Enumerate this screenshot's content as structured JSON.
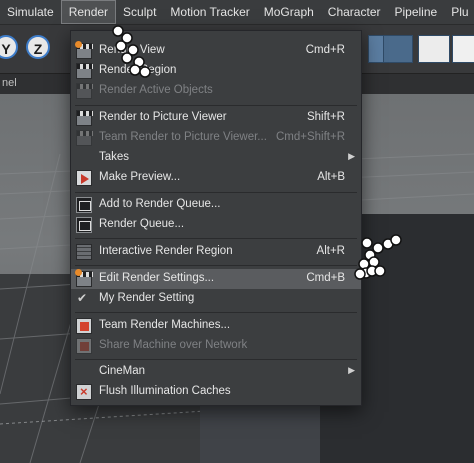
{
  "menubar": {
    "items": [
      "Simulate",
      "Render",
      "Sculpt",
      "Motion Tracker",
      "MoGraph",
      "Character",
      "Pipeline",
      "Plu"
    ]
  },
  "toolbar": {
    "icon_y": "Y",
    "icon_z": "Z"
  },
  "subbar": {
    "label": "nel"
  },
  "menu": {
    "items": [
      {
        "label": "Render View",
        "shortcut": "Cmd+R",
        "icon": "clapper-icon",
        "disabled": false
      },
      {
        "label": "Render Region",
        "shortcut": "",
        "icon": "clapper-icon",
        "disabled": false
      },
      {
        "label": "Render Active Objects",
        "shortcut": "",
        "icon": "clapper-icon",
        "disabled": true
      },
      {
        "label": "Render to Picture Viewer",
        "shortcut": "Shift+R",
        "icon": "clapper-icon",
        "disabled": false
      },
      {
        "label": "Team Render to Picture Viewer...",
        "shortcut": "Cmd+Shift+R",
        "icon": "clapper-icon",
        "disabled": true
      },
      {
        "label": "Takes",
        "shortcut": "",
        "icon": "",
        "disabled": false,
        "submenu": true
      },
      {
        "label": "Make Preview...",
        "shortcut": "Alt+B",
        "icon": "preview-icon",
        "disabled": false
      },
      {
        "label": "Add to Render Queue...",
        "shortcut": "",
        "icon": "queue-icon",
        "disabled": false
      },
      {
        "label": "Render Queue...",
        "shortcut": "",
        "icon": "queue-icon",
        "disabled": false
      },
      {
        "label": "Interactive Render Region",
        "shortcut": "Alt+R",
        "icon": "region-icon",
        "disabled": false
      },
      {
        "label": "Edit Render Settings...",
        "shortcut": "Cmd+B",
        "icon": "settings-icon",
        "disabled": false,
        "highlighted": true
      },
      {
        "label": "My Render Setting",
        "shortcut": "",
        "icon": "check-icon",
        "disabled": false
      },
      {
        "label": "Team Render Machines...",
        "shortcut": "",
        "icon": "machines-icon",
        "disabled": false
      },
      {
        "label": "Share Machine over Network",
        "shortcut": "",
        "icon": "network-icon",
        "disabled": true
      },
      {
        "label": "CineMan",
        "shortcut": "",
        "icon": "",
        "disabled": false,
        "submenu": true
      },
      {
        "label": "Flush Illumination Caches",
        "shortcut": "",
        "icon": "flush-icon",
        "disabled": false
      }
    ]
  }
}
